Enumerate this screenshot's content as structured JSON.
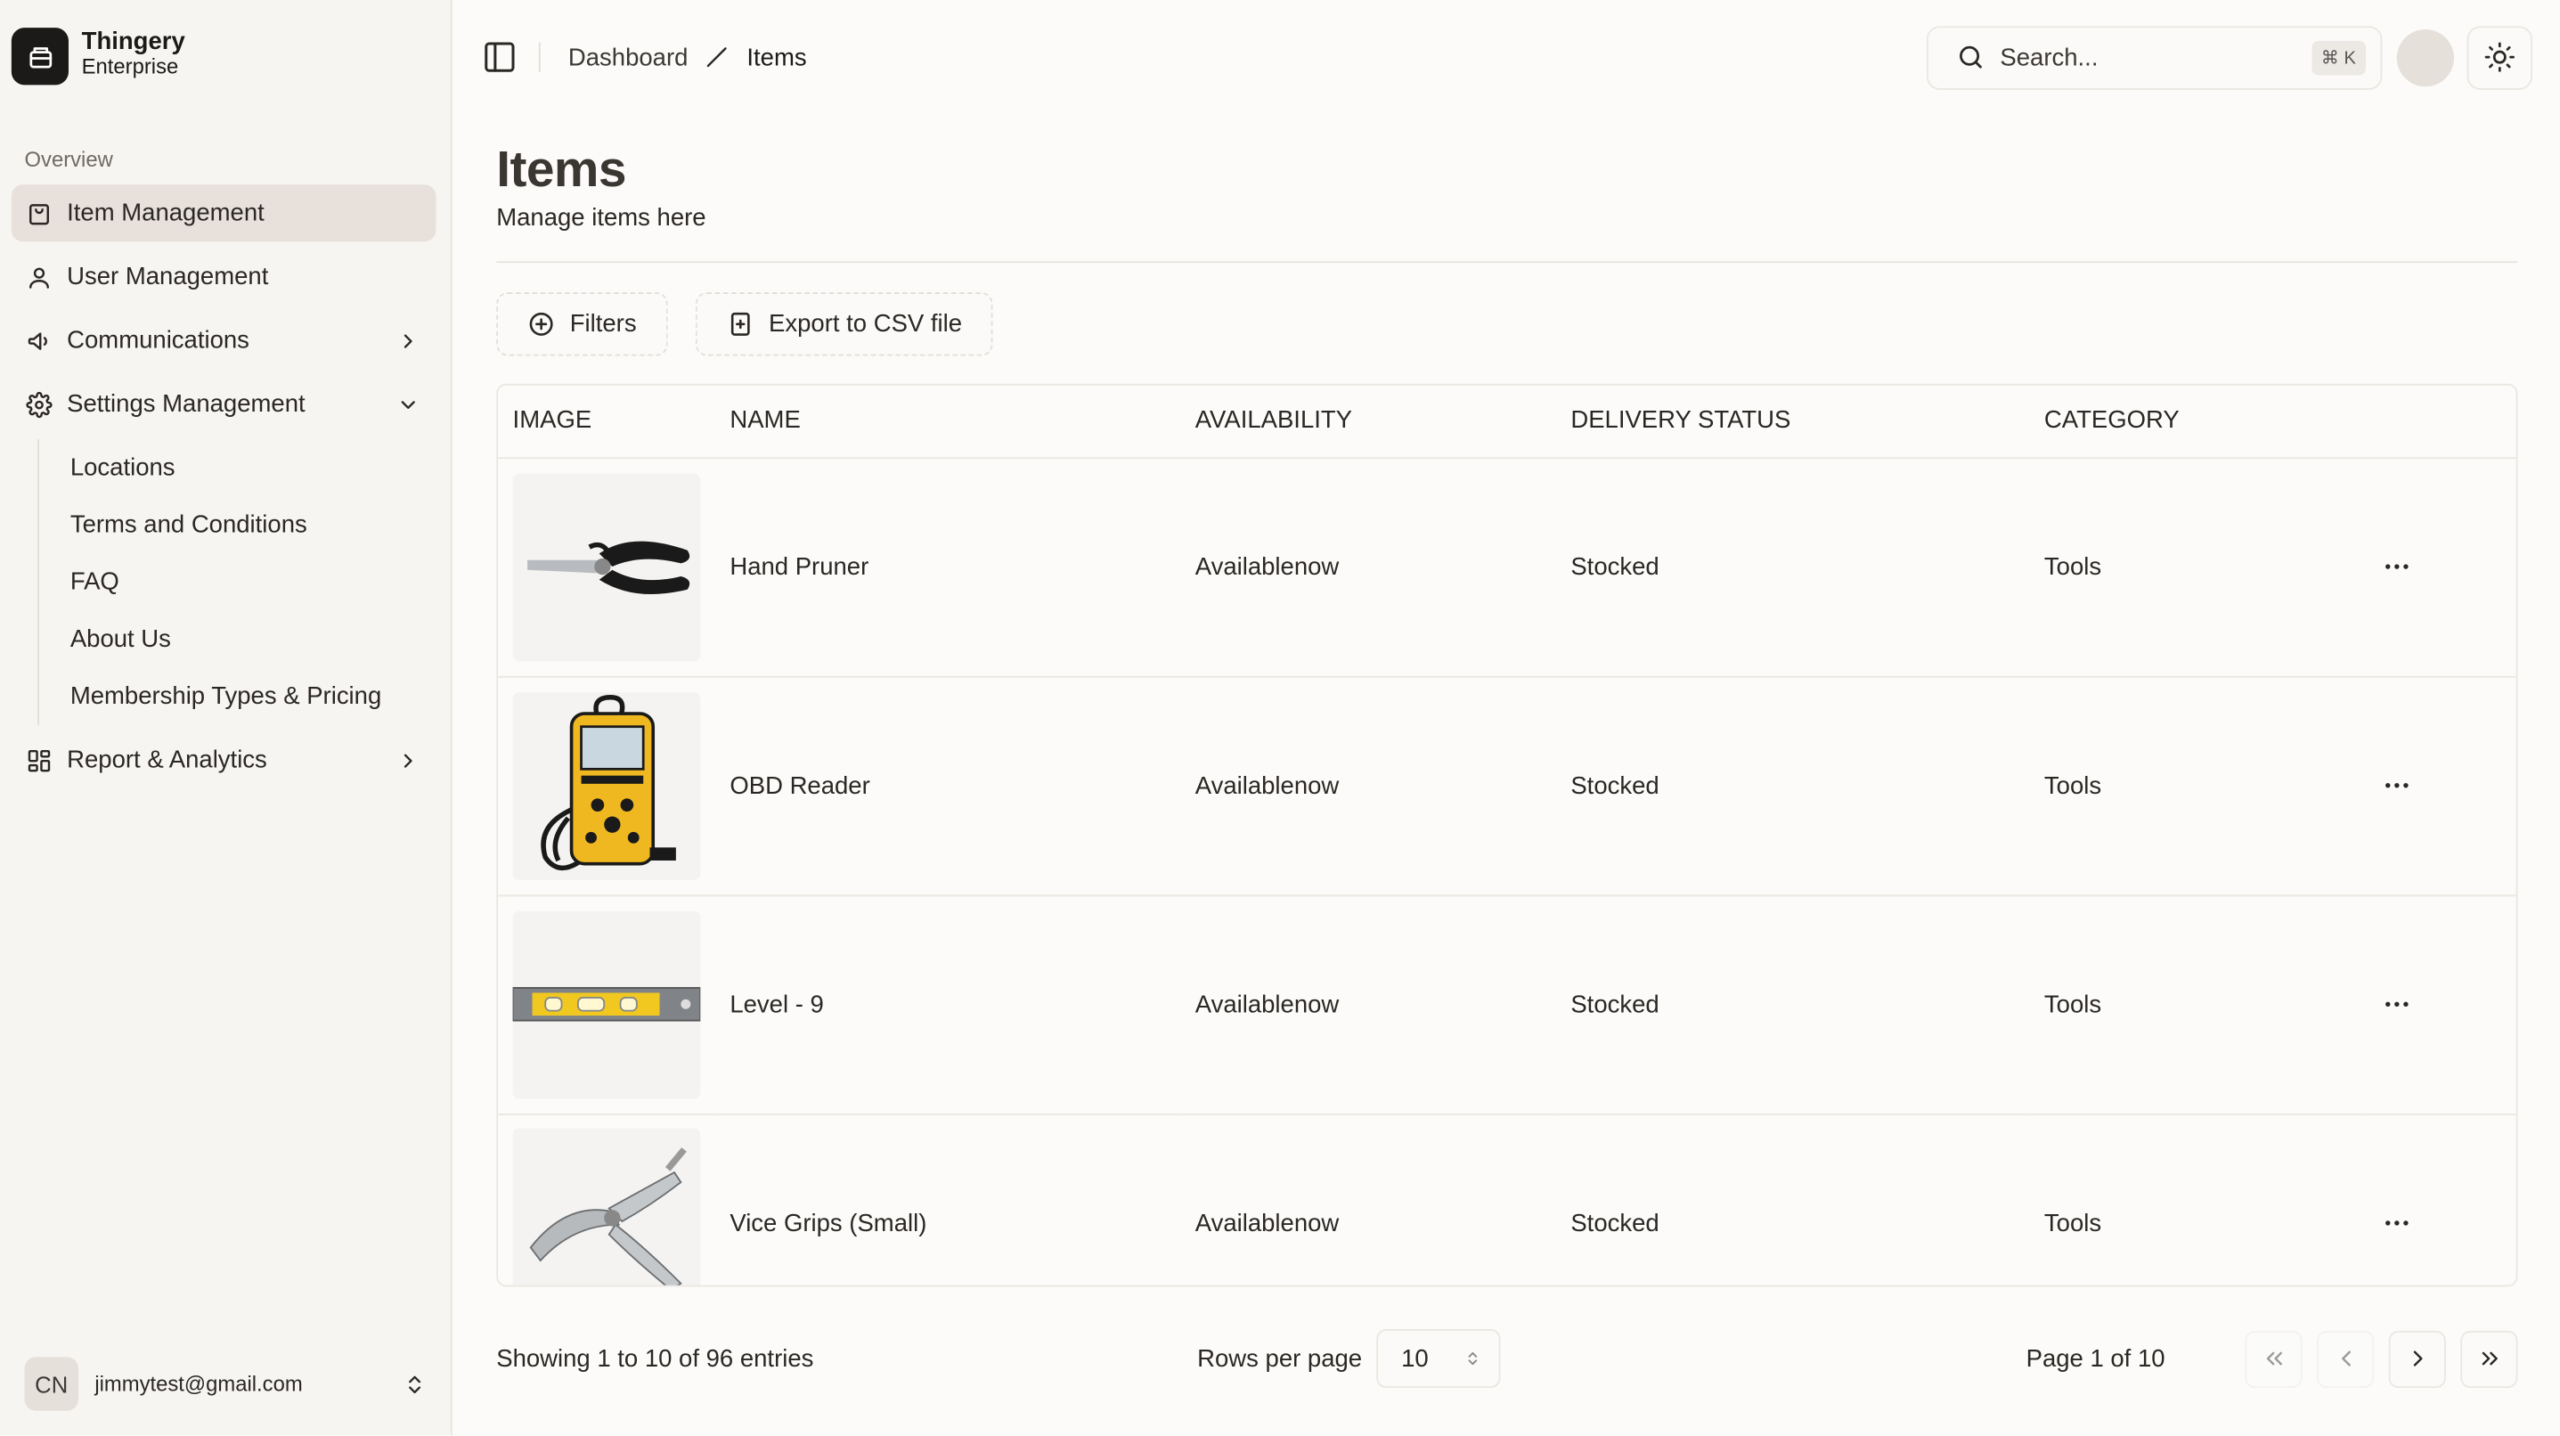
{
  "brand": {
    "name": "Thingery",
    "subtitle": "Enterprise"
  },
  "sidebar": {
    "section_label": "Overview",
    "items": [
      {
        "label": "Item Management",
        "icon": "shopping-bag-icon",
        "active": true
      },
      {
        "label": "User Management",
        "icon": "user-icon"
      },
      {
        "label": "Communications",
        "icon": "megaphone-icon",
        "chevron": "right"
      },
      {
        "label": "Settings Management",
        "icon": "gear-icon",
        "chevron": "down"
      }
    ],
    "sub_items": [
      {
        "label": "Locations"
      },
      {
        "label": "Terms and Conditions"
      },
      {
        "label": "FAQ"
      },
      {
        "label": "About Us"
      },
      {
        "label": "Membership Types & Pricing"
      }
    ],
    "report_item": {
      "label": "Report & Analytics",
      "icon": "dashboard-grid-icon",
      "chevron": "right"
    },
    "user": {
      "initials": "CN",
      "email": "jimmytest@gmail.com"
    }
  },
  "header": {
    "breadcrumb": [
      {
        "label": "Dashboard"
      },
      {
        "label": "Items"
      }
    ],
    "search": {
      "placeholder": "Search...",
      "shortcut": "⌘ K"
    }
  },
  "page": {
    "title": "Items",
    "subtitle": "Manage items here",
    "buttons": {
      "filters": "Filters",
      "export": "Export to CSV file"
    }
  },
  "table": {
    "columns": [
      "IMAGE",
      "NAME",
      "AVAILABILITY",
      "DELIVERY STATUS",
      "CATEGORY"
    ],
    "rows": [
      {
        "name": "Hand Pruner",
        "availability": "Availablenow",
        "delivery": "Stocked",
        "category": "Tools",
        "image": "hand-pruner"
      },
      {
        "name": "OBD Reader",
        "availability": "Availablenow",
        "delivery": "Stocked",
        "category": "Tools",
        "image": "obd-reader"
      },
      {
        "name": "Level - 9",
        "availability": "Availablenow",
        "delivery": "Stocked",
        "category": "Tools",
        "image": "level"
      },
      {
        "name": "Vice Grips (Small)",
        "availability": "Availablenow",
        "delivery": "Stocked",
        "category": "Tools",
        "image": "vice-grips"
      }
    ]
  },
  "footer": {
    "entries": "Showing 1 to 10 of 96 entries",
    "rows_per_page_label": "Rows per page",
    "rows_per_page_value": "10",
    "page_info": "Page 1 of 10"
  }
}
